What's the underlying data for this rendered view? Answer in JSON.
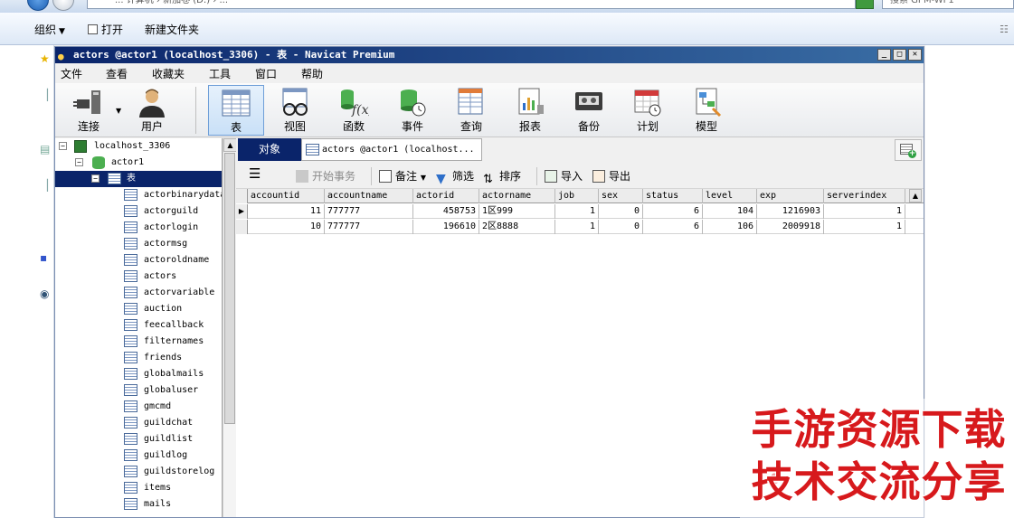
{
  "explorer": {
    "address_text": "... 计算机 › 新加卷 (D:) › ...",
    "search_placeholder": "搜索 GPM-WF1",
    "cmd": {
      "organize": "组织",
      "open": "打开",
      "new_folder": "新建文件夹"
    }
  },
  "navicat": {
    "title": "actors @actor1 (localhost_3306) - 表 - Navicat Premium",
    "menu": [
      "文件",
      "查看",
      "收藏夹",
      "工具",
      "窗口",
      "帮助"
    ],
    "toolbar": [
      "连接",
      "用户",
      "表",
      "视图",
      "函数",
      "事件",
      "查询",
      "报表",
      "备份",
      "计划",
      "模型"
    ],
    "tree": {
      "connection": "localhost_3306",
      "database": "actor1",
      "folder": "表",
      "tables": [
        "actorbinarydata",
        "actorguild",
        "actorlogin",
        "actormsg",
        "actoroldname",
        "actors",
        "actorvariable",
        "auction",
        "feecallback",
        "filternames",
        "friends",
        "globalmails",
        "globaluser",
        "gmcmd",
        "guildchat",
        "guildlist",
        "guildlog",
        "guildstorelog",
        "items",
        "mails"
      ]
    },
    "tabs": {
      "objects": "对象",
      "doc": "actors @actor1 (localhost..."
    },
    "gridbar": {
      "begin_tx": "开始事务",
      "memo": "备注",
      "filter": "筛选",
      "sort": "排序",
      "import": "导入",
      "export": "导出"
    },
    "grid": {
      "columns": [
        "accountid",
        "accountname",
        "actorid",
        "actorname",
        "job",
        "sex",
        "status",
        "level",
        "exp",
        "serverindex"
      ],
      "rows": [
        [
          "11",
          "777777",
          "458753",
          "1区999",
          "1",
          "0",
          "6",
          "104",
          "1216903",
          "1"
        ],
        [
          "10",
          "777777",
          "196610",
          "2区8888",
          "1",
          "0",
          "6",
          "106",
          "2009918",
          "1"
        ]
      ]
    }
  },
  "watermark": {
    "line1": "手游资源下载",
    "line2": "技术交流分享"
  }
}
